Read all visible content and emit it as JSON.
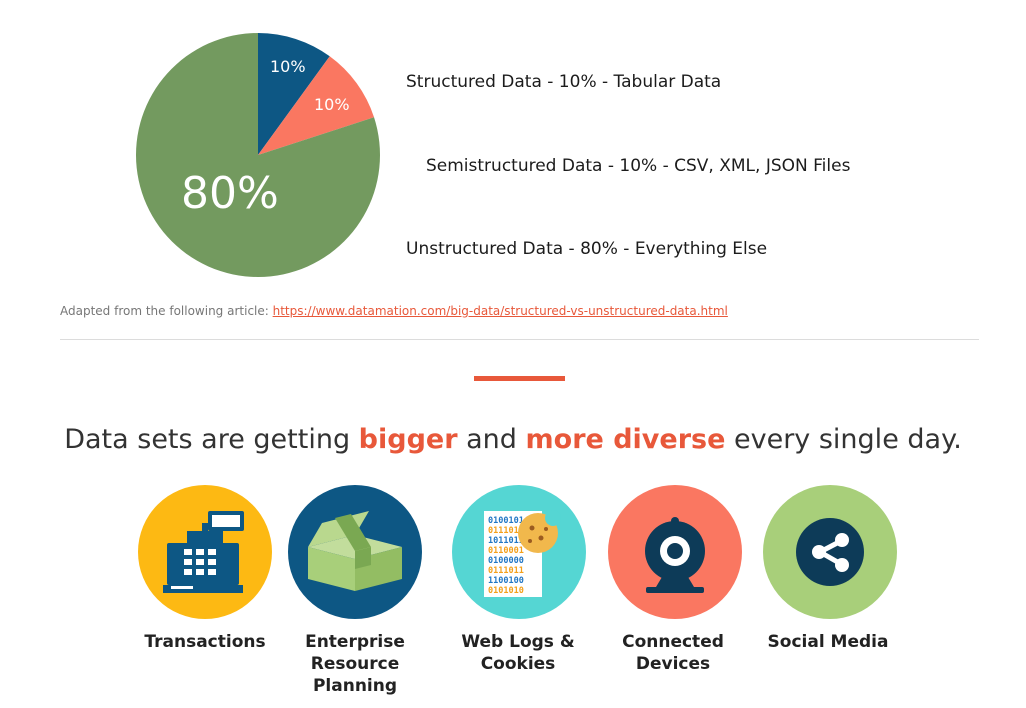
{
  "pie": {
    "slices": [
      {
        "label": "10%",
        "value": 10,
        "color": "#0d5784"
      },
      {
        "label": "10%",
        "value": 10,
        "color": "#fa7761"
      },
      {
        "label": "80%",
        "value": 80,
        "color": "#739a5f"
      }
    ],
    "legend": [
      "Structured Data - 10% - Tabular Data",
      "Semistructured Data - 10% - CSV, XML, JSON Files",
      "Unstructured Data - 80% - Everything Else"
    ]
  },
  "source": {
    "prefix": "Adapted from the following article: ",
    "link_text": "https://www.datamation.com/big-data/structured-vs-unstructured-data.html"
  },
  "headline": {
    "part1": "Data sets are getting ",
    "highlight1": "bigger",
    "part2": " and ",
    "highlight2": "more diverse",
    "part3": " every single day."
  },
  "colors": {
    "accent": "#e8583a",
    "navy": "#0d5784",
    "yellow": "#fdb913",
    "teal": "#55d6d3",
    "coral": "#fa7761",
    "green": "#a8cf7a"
  },
  "sources": [
    {
      "label": "Transactions",
      "icon": "cash-register-icon"
    },
    {
      "label": "Enterprise Resource Planning",
      "icon": "box-icon"
    },
    {
      "label": "Web Logs & Cookies",
      "icon": "binary-cookie-icon"
    },
    {
      "label": "Connected Devices",
      "icon": "webcam-icon"
    },
    {
      "label": "Social Media",
      "icon": "share-icon"
    }
  ]
}
